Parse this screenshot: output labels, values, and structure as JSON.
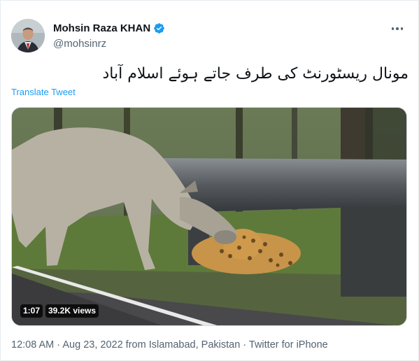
{
  "author": {
    "display_name": "Mohsin Raza KHAN",
    "handle": "@mohsinrz"
  },
  "icons": {
    "verified": "verified-badge-icon",
    "more": "more-options-icon"
  },
  "tweet": {
    "text": "مونال ریسٹورنٹ کی طرف جاتے ہوئے اسلام آباد",
    "translate_label": "Translate Tweet"
  },
  "media": {
    "duration": "1:07",
    "views": "39.2K views"
  },
  "meta": {
    "time": "12:08 AM",
    "separator_1": " · ",
    "date": "Aug 23, 2022",
    "location": " from Islamabad, Pakistan",
    "separator_2": " · ",
    "source": "Twitter for iPhone"
  },
  "colors": {
    "link": "#1d9bf0",
    "verified": "#1d9bf0",
    "secondary_text": "#536471"
  }
}
